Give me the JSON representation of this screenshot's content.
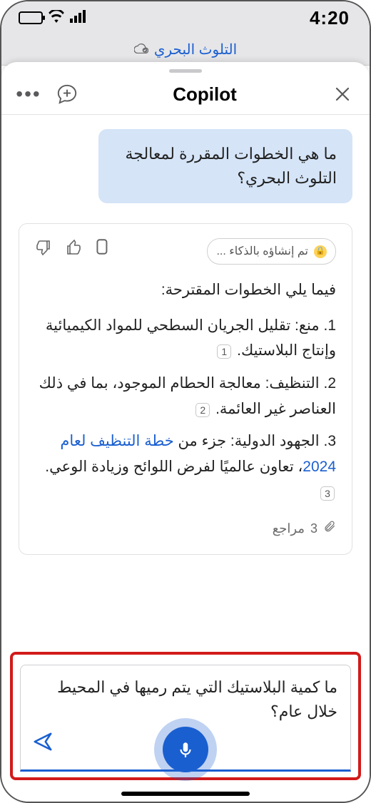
{
  "status_bar": {
    "time": "4:20"
  },
  "doc_header": {
    "title": "التلوث البحري"
  },
  "sheet": {
    "title": "Copilot",
    "menu_icon": "more-icon",
    "compose_icon": "new-chat-icon",
    "close_icon": "close-icon",
    "user_message": "ما هي الخطوات المقررة لمعالجة التلوث البحري؟",
    "assistant": {
      "ai_badge": "تم إنشاؤه بالذكاء ...",
      "intro": "فيما يلي الخطوات المقترحة:",
      "items": [
        {
          "num": "1.",
          "label": "منع:",
          "text": " تقليل الجريان السطحي للمواد الكيميائية وإنتاج البلاستيك.",
          "cite": "1"
        },
        {
          "num": "2.",
          "label": "التنظيف:",
          "text": " معالجة الحطام الموجود، بما في ذلك العناصر غير العائمة.",
          "cite": "2"
        },
        {
          "num": "3.",
          "label": "الجهود الدولية:",
          "link": "خطة التنظيف لعام 2024",
          "pre": " جزء من ",
          "post": "، تعاون عالميًا لفرض اللوائح وزيادة الوعي.",
          "cite": "3"
        }
      ],
      "refs_count": "3",
      "refs_label": "مراجع"
    },
    "input": {
      "text": "ما كمية البلاستيك التي يتم رميها في المحيط خلال عام؟"
    }
  }
}
